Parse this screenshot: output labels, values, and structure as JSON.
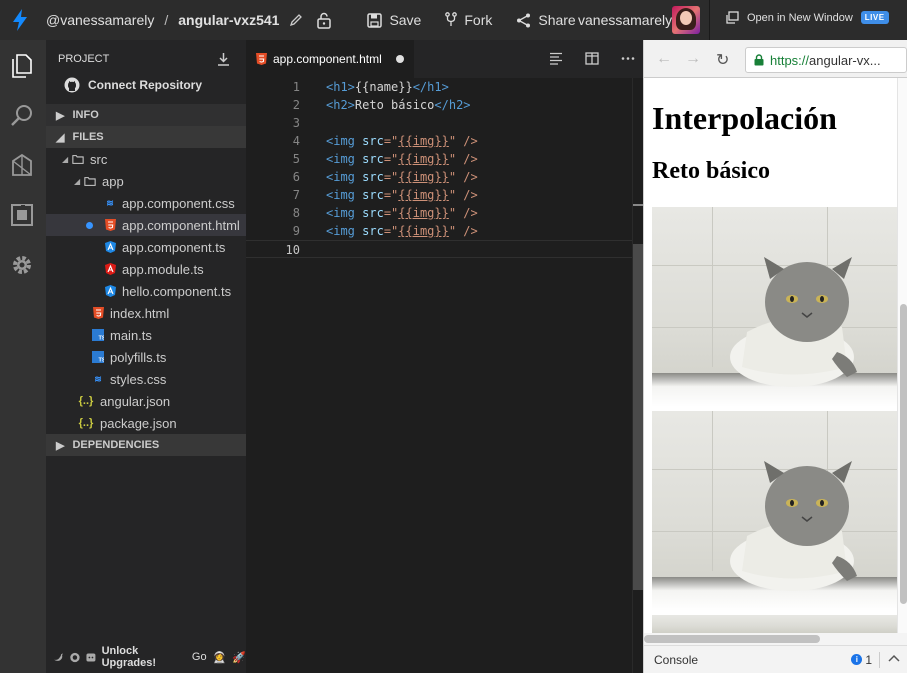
{
  "topbar": {
    "logo_icon": "lightning-icon",
    "username": "@vanessamarely",
    "separator": "/",
    "project_name": "angular-vxz541",
    "save_label": "Save",
    "fork_label": "Fork",
    "share_label": "Share",
    "account_name": "vanessamarely",
    "open_window_label": "Open in New Window",
    "live_badge": "LIVE"
  },
  "sidebar": {
    "header": "PROJECT",
    "connect_label": "Connect Repository",
    "sections": {
      "info": "INFO",
      "files": "FILES",
      "dependencies": "DEPENDENCIES"
    },
    "tree": [
      {
        "label": "src",
        "kind": "folder"
      },
      {
        "label": "app",
        "kind": "folder"
      },
      {
        "label": "app.component.css",
        "kind": "css"
      },
      {
        "label": "app.component.html",
        "kind": "html"
      },
      {
        "label": "app.component.ts",
        "kind": "angular-blue"
      },
      {
        "label": "app.module.ts",
        "kind": "angular-red"
      },
      {
        "label": "hello.component.ts",
        "kind": "angular-blue"
      },
      {
        "label": "index.html",
        "kind": "html"
      },
      {
        "label": "main.ts",
        "kind": "ts"
      },
      {
        "label": "polyfills.ts",
        "kind": "ts"
      },
      {
        "label": "styles.css",
        "kind": "css"
      },
      {
        "label": "angular.json",
        "kind": "json"
      },
      {
        "label": "package.json",
        "kind": "json"
      }
    ],
    "footer": {
      "unlock_label": "Unlock Upgrades!",
      "go_label": "Go"
    }
  },
  "editor": {
    "tab_label": "app.component.html",
    "line_numbers": [
      "1",
      "2",
      "3",
      "4",
      "5",
      "6",
      "7",
      "8",
      "9",
      "10"
    ],
    "lines": {
      "l1_open": "<h1>",
      "l1_text": "{{name}}",
      "l1_close": "</h1>",
      "l2_open": "<h2>",
      "l2_text": "Reto básico",
      "l2_close": "</h2>",
      "img_tag": "<img",
      "img_attr": "src",
      "img_eq": "=\"",
      "img_val": "{{img}}",
      "img_end": "\" />"
    }
  },
  "preview": {
    "url_scheme": "https://",
    "url_rest": "angular-vx...",
    "h1": "Interpolación",
    "h2": "Reto básico",
    "console_label": "Console",
    "console_count": "1",
    "console_badge": "i"
  },
  "colors": {
    "accent": "#3f8ee8",
    "topbar_bg": "#2c2c2c",
    "sidebar_bg": "#252526",
    "editor_bg": "#1e1e1e",
    "html_icon": "#e44d26",
    "css_icon": "#3794ff",
    "angular_red": "#dd1b16",
    "angular_blue": "#1e88e5",
    "json_icon": "#cbcb41"
  }
}
